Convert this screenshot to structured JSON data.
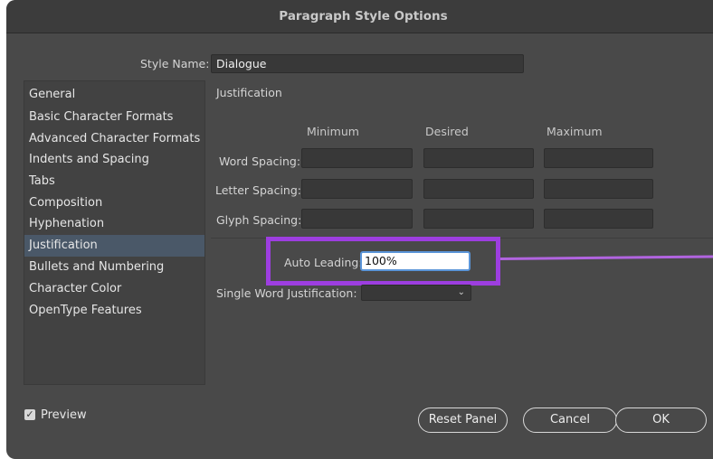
{
  "window": {
    "title": "Paragraph Style Options"
  },
  "style_name": {
    "label": "Style Name:",
    "value": "Dialogue"
  },
  "sidebar": {
    "items": [
      {
        "label": "General"
      },
      {
        "label": "Basic Character Formats"
      },
      {
        "label": "Advanced Character Formats"
      },
      {
        "label": "Indents and Spacing"
      },
      {
        "label": "Tabs"
      },
      {
        "label": "Composition"
      },
      {
        "label": "Hyphenation"
      },
      {
        "label": "Justification",
        "selected": true
      },
      {
        "label": "Bullets and Numbering"
      },
      {
        "label": "Character Color"
      },
      {
        "label": "OpenType Features"
      }
    ]
  },
  "panel": {
    "section_title": "Justification",
    "columns": {
      "minimum": "Minimum",
      "desired": "Desired",
      "maximum": "Maximum"
    },
    "rows": {
      "word_spacing": "Word Spacing:",
      "letter_spacing": "Letter Spacing:",
      "glyph_spacing": "Glyph Spacing:"
    },
    "auto_leading": {
      "label": "Auto Leading:",
      "value": "100%"
    },
    "single_word_justification": {
      "label": "Single Word Justification:",
      "value": ""
    }
  },
  "footer": {
    "preview": {
      "label": "Preview",
      "checked": true
    },
    "reset_label": "Reset Panel",
    "cancel_label": "Cancel",
    "ok_label": "OK"
  },
  "colors": {
    "dialog_bg": "#494949",
    "titlebar_bg": "#3c3c3c",
    "selected_item_bg": "#4a5868",
    "highlight_annotation": "#9d3ee0",
    "focus_ring": "#5b95d8"
  },
  "icons": {
    "chevron": "chevron-down-icon",
    "check": "checkmark-icon"
  }
}
